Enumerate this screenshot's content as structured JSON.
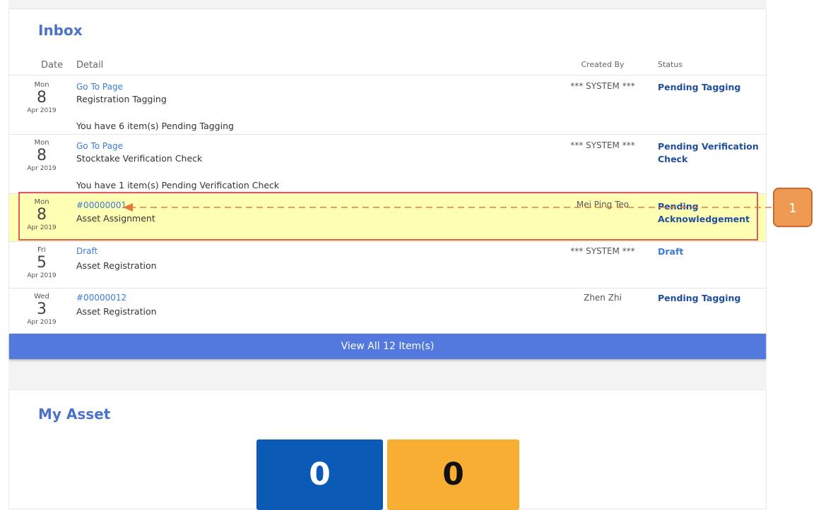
{
  "inbox": {
    "title": "Inbox",
    "headers": {
      "date": "Date",
      "detail": "Detail",
      "created_by": "Created By",
      "status": "Status"
    },
    "rows": [
      {
        "day": "Mon",
        "date": "8",
        "month_year": "Apr 2019",
        "link": "Go To Page",
        "title": "Registration Tagging",
        "message": "You have 6 item(s) Pending Tagging",
        "created_by": "*** SYSTEM ***",
        "status": "Pending Tagging"
      },
      {
        "day": "Mon",
        "date": "8",
        "month_year": "Apr 2019",
        "link": "Go To Page",
        "title": "Stocktake Verification Check",
        "message": "You have 1 item(s) Pending Verification Check",
        "created_by": "*** SYSTEM ***",
        "status": "Pending Verification Check"
      },
      {
        "day": "Mon",
        "date": "8",
        "month_year": "Apr 2019",
        "link": "#00000001",
        "title": "Asset Assignment",
        "message": "",
        "created_by": "Mei Ping Teo",
        "status": "Pending Acknowledgement"
      },
      {
        "day": "Fri",
        "date": "5",
        "month_year": "Apr 2019",
        "link": "Draft",
        "title": "Asset Registration",
        "message": "",
        "created_by": "*** SYSTEM ***",
        "status": "Draft"
      },
      {
        "day": "Wed",
        "date": "3",
        "month_year": "Apr 2019",
        "link": "#00000012",
        "title": "Asset Registration",
        "message": "",
        "created_by": "Zhen Zhi",
        "status": "Pending Tagging"
      }
    ],
    "view_all": "View All 12 Item(s)"
  },
  "my_asset": {
    "title": "My Asset",
    "tiles": [
      {
        "value": "0",
        "color": "#0a5ab6"
      },
      {
        "value": "0",
        "color": "#f7ae33"
      }
    ]
  },
  "annotation": {
    "label": "1",
    "box_color": "#e25b5b",
    "badge_color": "#ef9a53"
  }
}
